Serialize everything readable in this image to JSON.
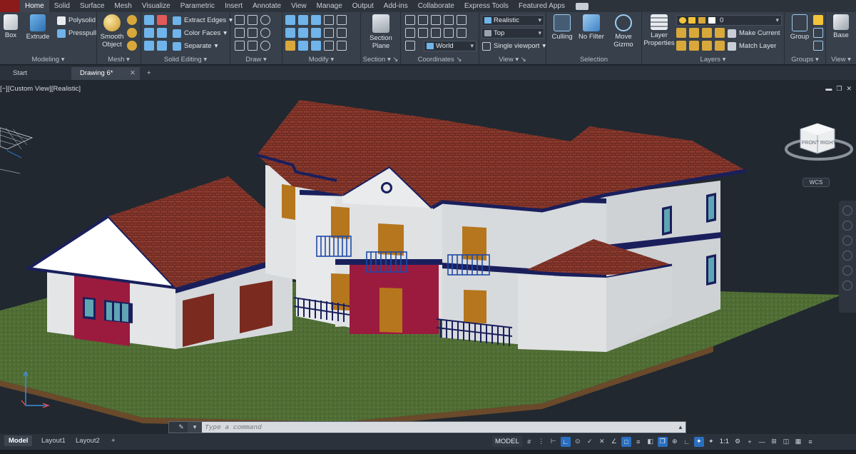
{
  "menubar": {
    "tabs": [
      "Home",
      "Solid",
      "Surface",
      "Mesh",
      "Visualize",
      "Parametric",
      "Insert",
      "Annotate",
      "View",
      "Manage",
      "Output",
      "Add-ins",
      "Collaborate",
      "Express Tools",
      "Featured Apps"
    ],
    "active_tab": "Home"
  },
  "ribbon": {
    "modeling": {
      "title": "Modeling",
      "box": "Box",
      "extrude": "Extrude",
      "polysolid": "Polysolid",
      "presspull": "Presspull"
    },
    "mesh": {
      "title": "Mesh",
      "smooth_object": "Smooth\nObject"
    },
    "solid_editing": {
      "title": "Solid Editing",
      "extract_edges": "Extract Edges",
      "color_faces": "Color Faces",
      "separate": "Separate"
    },
    "draw": {
      "title": "Draw"
    },
    "modify": {
      "title": "Modify"
    },
    "section": {
      "title": "Section",
      "section_plane": "Section\nPlane"
    },
    "coordinates": {
      "title": "Coordinates",
      "ucs_value": "World"
    },
    "view": {
      "title": "View",
      "visual_style": "Realistic",
      "view_name": "Top",
      "viewport": "Single viewport"
    },
    "selection": {
      "title": "Selection",
      "culling": "Culling",
      "no_filter": "No Filter",
      "move_gizmo": "Move\nGizmo"
    },
    "layers": {
      "title": "Layers",
      "layer_properties": "Layer\nProperties",
      "layer_value": "0",
      "make_current": "Make Current",
      "match_layer": "Match Layer"
    },
    "groups": {
      "title": "Groups",
      "group": "Group"
    },
    "view2": {
      "title": "View",
      "base": "Base"
    }
  },
  "file_tabs": {
    "start": "Start",
    "drawing": "Drawing 6*"
  },
  "viewport": {
    "label": "[−][Custom View][Realistic]",
    "viewcube_front": "FRONT",
    "viewcube_right": "RIGHT",
    "wcs": "WCS"
  },
  "command": {
    "placeholder": "Type a command"
  },
  "layout_tabs": [
    "Model",
    "Layout1",
    "Layout2"
  ],
  "status": {
    "model": "MODEL",
    "scale": "1:1"
  },
  "colors": {
    "accent": "#2a6fbf",
    "roof": "#8b3a2e",
    "wall": "#e2e4e6",
    "trim": "#1a1f5c",
    "door": "#b5761d",
    "accent_wall": "#9b1b3f",
    "grass": "#4f6d34"
  }
}
